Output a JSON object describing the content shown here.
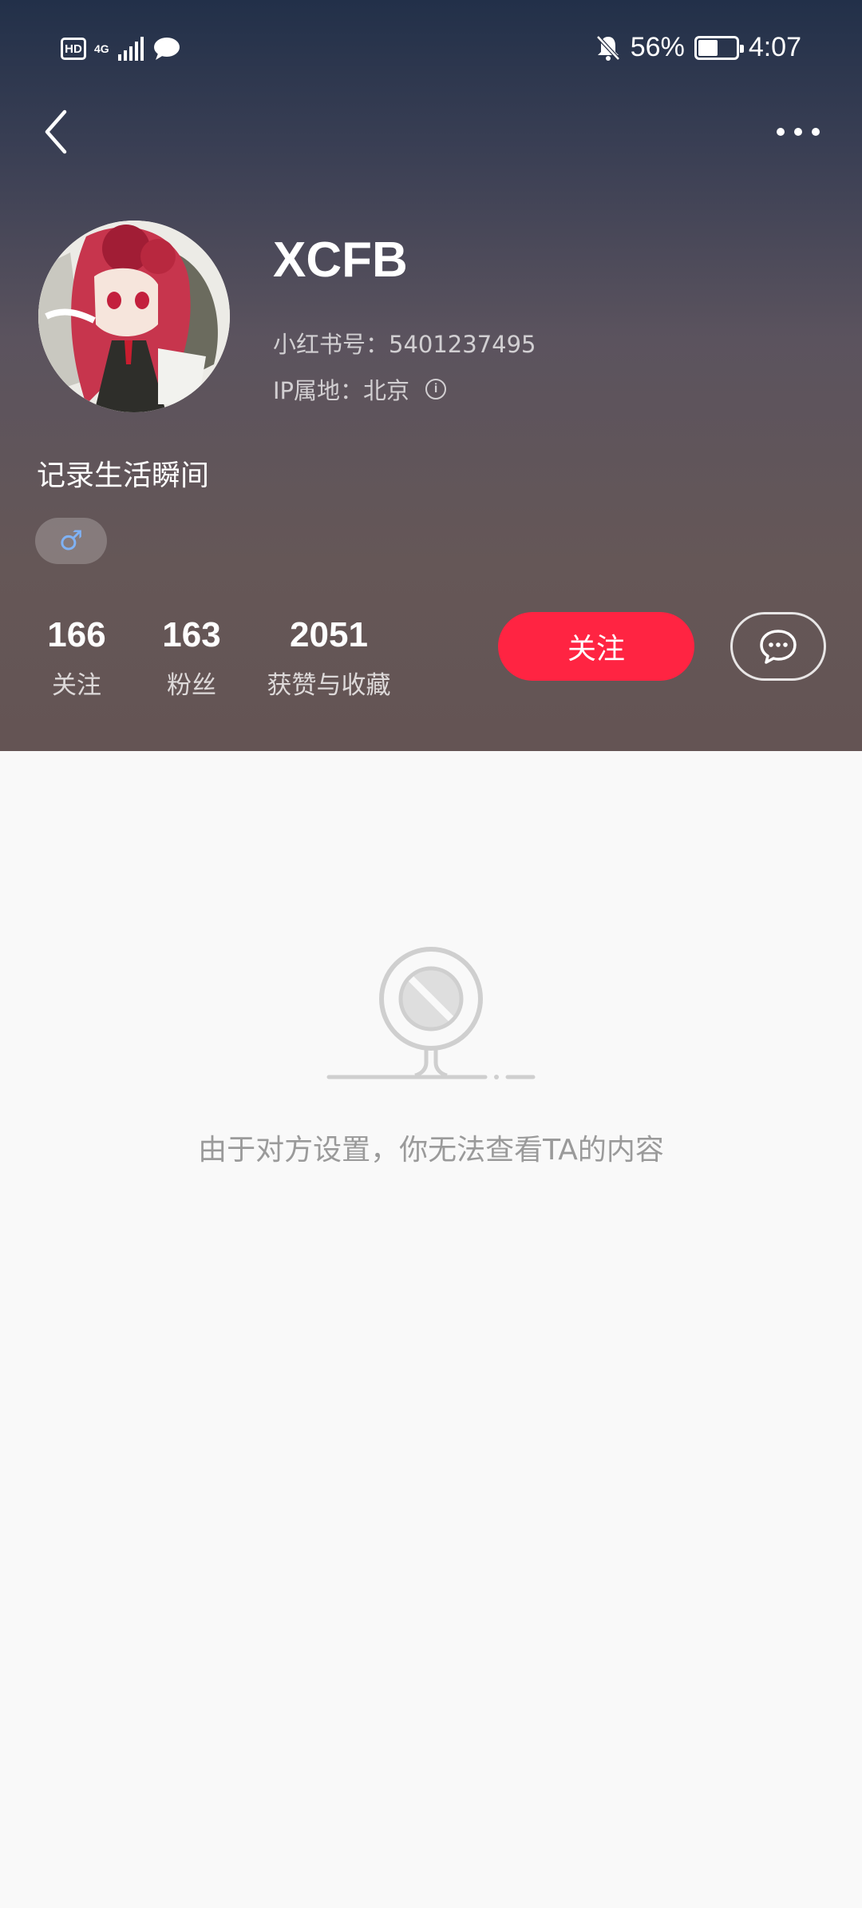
{
  "status_bar": {
    "hd": "HD",
    "network": "4G",
    "battery": "56%",
    "battery_level": 0.56,
    "time": "4:07"
  },
  "profile": {
    "name": "XCFB",
    "id_line": "小红书号：5401237495",
    "ip_line": "IP属地：北京",
    "bio": "记录生活瞬间",
    "gender_symbol": "♂"
  },
  "stats": [
    {
      "num": "166",
      "label": "关注"
    },
    {
      "num": "163",
      "label": "粉丝"
    },
    {
      "num": "2051",
      "label": "获赞与收藏"
    }
  ],
  "actions": {
    "follow_label": "关注"
  },
  "empty_state": {
    "message": "由于对方设置，你无法查看TA的内容"
  },
  "colors": {
    "accent": "#ff2442",
    "gender": "#7fb2f5",
    "muted_text": "#9a9a9a",
    "background": "#f9f9f9"
  }
}
